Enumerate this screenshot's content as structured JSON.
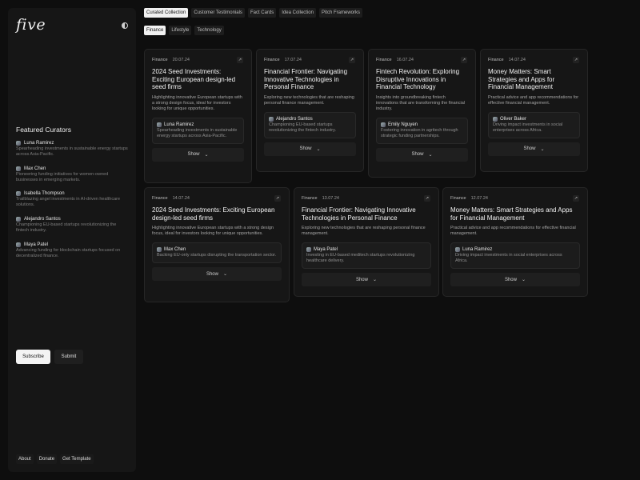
{
  "brand": {
    "logo": "five"
  },
  "sidebar": {
    "featured_title": "Featured Curators",
    "curators": [
      {
        "name": "Luna Ramirez",
        "desc": "Spearheading investments in sustainable energy startups across Asia-Pacific."
      },
      {
        "name": "Max Chen",
        "desc": "Pioneering funding initiatives for women-owned businesses in emerging markets."
      },
      {
        "name": "Isabella Thompson",
        "desc": "Trailblazing angel investments in AI-driven healthcare solutions."
      },
      {
        "name": "Alejandro Santos",
        "desc": "Championing EU-based startups revolutionizing the fintech industry."
      },
      {
        "name": "Maya Patel",
        "desc": "Advancing funding for blockchain startups focused on decentralized finance."
      }
    ],
    "subscribe_label": "Subscribe",
    "submit_label": "Submit",
    "footer": [
      "About",
      "Donate",
      "Get Template"
    ]
  },
  "top_tabs": [
    "Curated Collection",
    "Customer Testimonials",
    "Fact Cards",
    "Idea Collection",
    "Pitch Frameworks"
  ],
  "filter_tabs": [
    "Finance",
    "Lifestyle",
    "Technology"
  ],
  "show_label": "Show",
  "cards": [
    {
      "category": "Finance",
      "date": "20.07.24",
      "title": "2024 Seed Investments: Exciting European design-led seed firms",
      "summary": "Highlighting innovative European startups with a strong design focus, ideal for investors looking for unique opportunities.",
      "curator": "Luna Ramirez",
      "quote": "Spearheading investments in sustainable energy startups across Asia-Pacific."
    },
    {
      "category": "Finance",
      "date": "17.07.24",
      "title": "Financial Frontier: Navigating Innovative Technologies in Personal Finance",
      "summary": "Exploring new technologies that are reshaping personal finance management.",
      "curator": "Alejandro Santos",
      "quote": "Championing EU-based startups revolutionizing the fintech industry."
    },
    {
      "category": "Finance",
      "date": "16.07.24",
      "title": "Fintech Revolution: Exploring Disruptive Innovations in Financial Technology",
      "summary": "Insights into groundbreaking fintech innovations that are transforming the financial industry.",
      "curator": "Emily Nguyen",
      "quote": "Fostering innovation in agritech through strategic funding partnerships."
    },
    {
      "category": "Finance",
      "date": "14.07.24",
      "title": "Money Matters: Smart Strategies and Apps for Financial Management",
      "summary": "Practical advice and app recommendations for effective financial management.",
      "curator": "Oliver Baker",
      "quote": "Driving impact investments in social enterprises across Africa."
    },
    {
      "category": "Finance",
      "date": "14.07.24",
      "title": "2024 Seed Investments: Exciting European design-led seed firms",
      "summary": "Highlighting innovative European startups with a strong design focus, ideal for investors looking for unique opportunities.",
      "curator": "Max Chen",
      "quote": "Backing EU-only startups disrupting the transportation sector."
    },
    {
      "category": "Finance",
      "date": "13.07.24",
      "title": "Financial Frontier: Navigating Innovative Technologies in Personal Finance",
      "summary": "Exploring new technologies that are reshaping personal finance management.",
      "curator": "Maya Patel",
      "quote": "Investing in EU-based meditech startups revolutionizing healthcare delivery."
    },
    {
      "category": "Finance",
      "date": "12.07.24",
      "title": "Money Matters: Smart Strategies and Apps for Financial Management",
      "summary": "Practical advice and app recommendations for effective financial management.",
      "curator": "Luna Ramirez",
      "quote": "Driving impact investments in social enterprises across Africa."
    }
  ]
}
